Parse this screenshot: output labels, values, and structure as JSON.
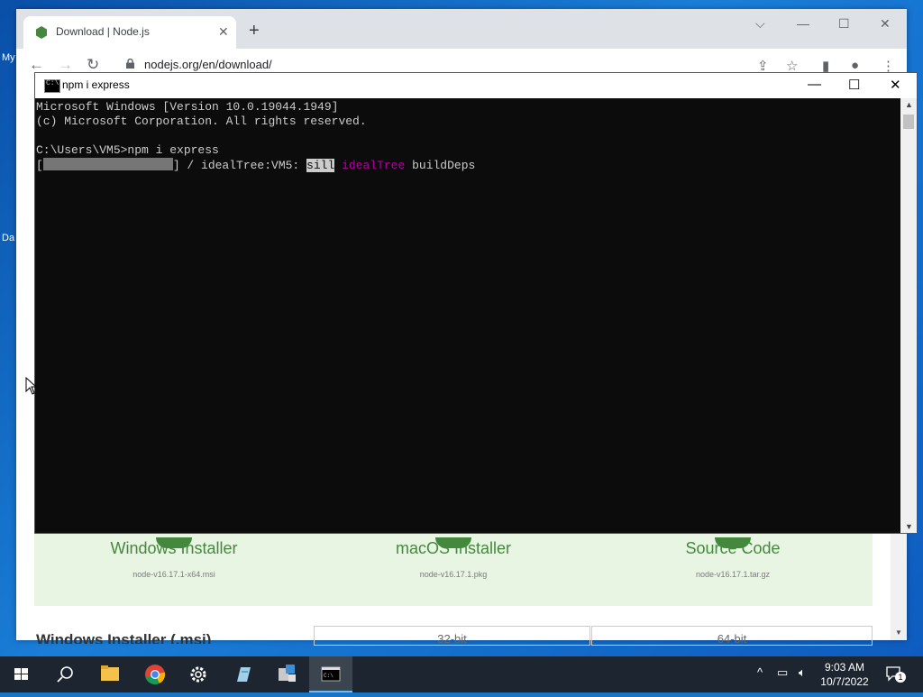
{
  "desktop": {
    "icon_labels": [
      "My",
      "Da"
    ]
  },
  "browser": {
    "tab_title": "Download | Node.js",
    "url": "nodejs.org/en/download/",
    "new_tab_icon": "plus-icon"
  },
  "page": {
    "downloads": [
      {
        "name": "Windows Installer",
        "file": "node-v16.17.1-x64.msi"
      },
      {
        "name": "macOS Installer",
        "file": "node-v16.17.1.pkg"
      },
      {
        "name": "Source Code",
        "file": "node-v16.17.1.tar.gz"
      }
    ],
    "section_heading": "Windows Installer (.msi)",
    "bit_options": [
      "32-bit",
      "64-bit"
    ]
  },
  "console": {
    "title": "npm i express",
    "lines": [
      "Microsoft Windows [Version 10.0.19044.1949]",
      "(c) Microsoft Corporation. All rights reserved.",
      "",
      "C:\\Users\\VM5>npm i express"
    ],
    "progress": {
      "open_bracket": "[",
      "close": "] / idealTree:VM5: ",
      "level": "sill",
      "tag": "idealTree",
      "message": " buildDeps",
      "fraction": 1.0
    }
  },
  "taskbar": {
    "apps": [
      "start-icon",
      "search-icon",
      "file-explorer-icon",
      "chrome-icon",
      "settings-icon",
      "notepad-icon",
      "app-icon",
      "terminal-icon"
    ],
    "time": "9:03 AM",
    "date": "10/7/2022",
    "notification_count": "1"
  },
  "colors": {
    "console_bg": "#0c0c0c",
    "console_fg": "#cccccc",
    "magenta": "#b4009e",
    "node_green": "#44883e",
    "taskbar": "#1d2630"
  }
}
